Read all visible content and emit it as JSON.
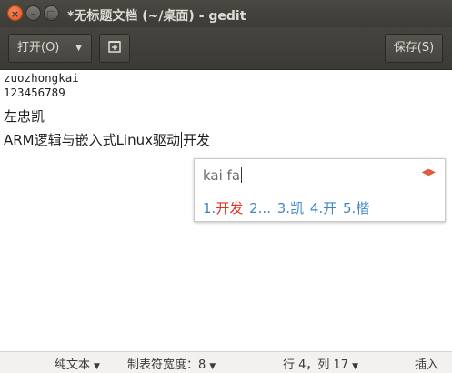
{
  "window": {
    "title": "*无标题文档 (~/桌面) - gedit",
    "close_glyph": "×",
    "minimize_glyph": "–",
    "maximize_glyph": "□"
  },
  "toolbar": {
    "open_label": "打开(O)",
    "open_arrow": "▼",
    "new_tab_glyph": "⊞",
    "save_label": "保存(S)"
  },
  "editor": {
    "lines": [
      "zuozhongkai",
      "123456789",
      "左忠凯"
    ],
    "line4_committed": "ARM逻辑与嵌入式Linux驱动",
    "line4_preedit": "开发"
  },
  "ime": {
    "input": "kai fa",
    "prev_glyph": "◀",
    "next_glyph": "▶",
    "candidates": [
      {
        "num": "1.",
        "text": "开发"
      },
      {
        "num": "2.",
        "text": ".."
      },
      {
        "num": "3.",
        "text": "凯"
      },
      {
        "num": "4.",
        "text": "开"
      },
      {
        "num": "5.",
        "text": "楷"
      }
    ]
  },
  "statusbar": {
    "language": "纯文本",
    "language_arrow": "▼",
    "tab_width": "制表符宽度：8",
    "tab_width_arrow": "▼",
    "position": "行 4，列 17",
    "position_arrow": "▼",
    "insert_mode": "插入"
  },
  "colors": {
    "titlebar_bg": "#3c3b37",
    "close_button": "#e2551f",
    "candidate_blue": "#3f87c7",
    "candidate_selected": "#e2311d"
  }
}
